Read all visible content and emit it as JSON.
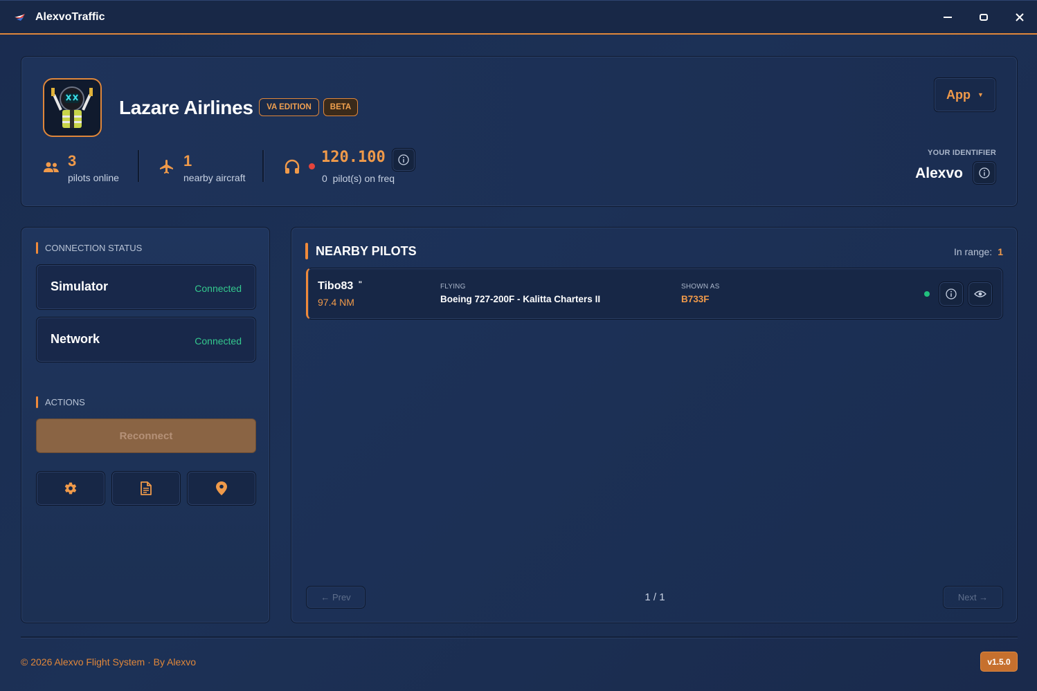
{
  "window": {
    "title": "AlexvoTraffic"
  },
  "header": {
    "va_name": "Lazare Airlines",
    "badge_edition": "VA EDITION",
    "badge_beta": "BETA",
    "app_button": "App",
    "stats": {
      "pilots_online_count": "3",
      "pilots_online_label": "pilots online",
      "nearby_aircraft_count": "1",
      "nearby_aircraft_label": "nearby aircraft",
      "frequency": "120.100",
      "freq_pilots_count": "0",
      "freq_pilots_label": "pilot(s) on freq"
    },
    "identifier_label": "YOUR IDENTIFIER",
    "identifier_value": "Alexvo"
  },
  "left_panel": {
    "connection_title": "CONNECTION STATUS",
    "connections": [
      {
        "name": "Simulator",
        "status": "Connected"
      },
      {
        "name": "Network",
        "status": "Connected"
      }
    ],
    "actions_title": "ACTIONS",
    "reconnect_label": "Reconnect",
    "tool_icons": [
      "gear-icon",
      "document-icon",
      "map-pin-icon"
    ]
  },
  "main_panel": {
    "title": "NEARBY PILOTS",
    "in_range_label": "In range:",
    "in_range_count": "1",
    "pilots": [
      {
        "callsign": "Tibo83",
        "callsign_mark": "\"",
        "distance": "97.4 NM",
        "flying_label": "FLYING",
        "aircraft": "Boeing 727-200F - Kalitta Charters II",
        "shown_as_label": "SHOWN AS",
        "shown_as": "B733F",
        "status": "online"
      }
    ],
    "pager": {
      "prev": "← Prev",
      "page": "1 / 1",
      "next": "Next →"
    }
  },
  "footer": {
    "copyright": "© 2026 Alexvo Flight System ·  By Alexvo",
    "version": "v1.5.0"
  },
  "colors": {
    "accent": "#f09a4a",
    "connected": "#34c98e",
    "online": "#22c07e",
    "live": "#e5443b",
    "background": "#1c3156"
  }
}
